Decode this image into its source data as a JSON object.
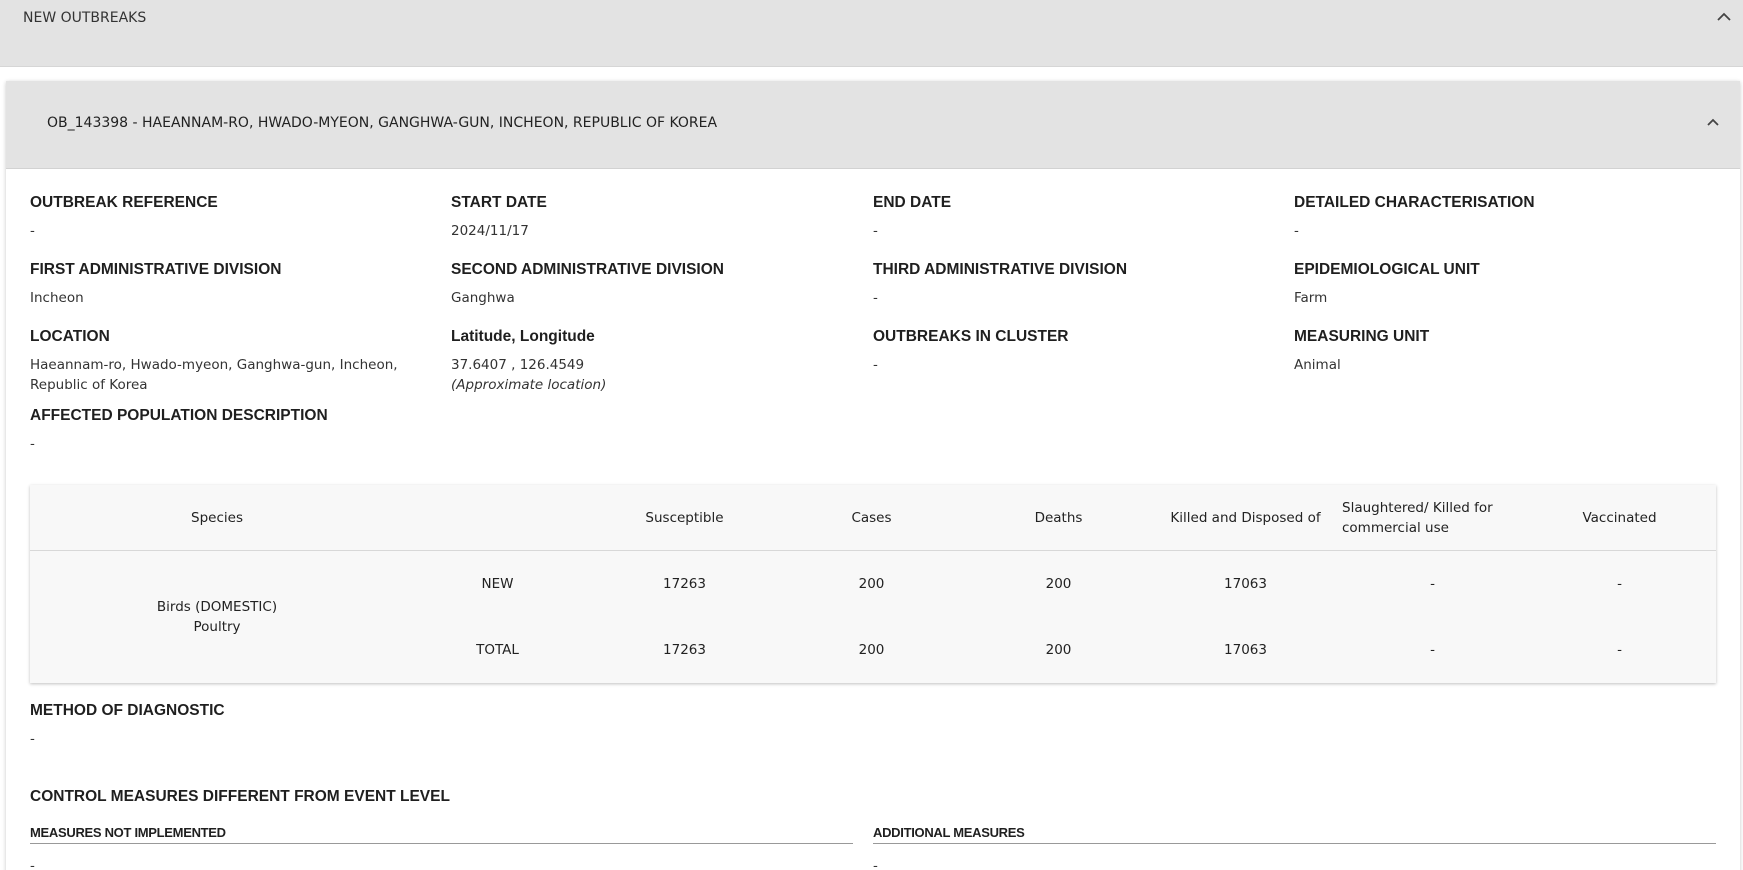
{
  "top_section": {
    "title": "NEW OUTBREAKS",
    "toggle_icon": "chevron-up-icon"
  },
  "outbreak": {
    "title": "OB_143398 - HAEANNAM-RO, HWADO-MYEON, GANGHWA-GUN, INCHEON, REPUBLIC OF KOREA",
    "toggle_icon": "chevron-up-icon"
  },
  "fields": {
    "outbreak_reference": {
      "label": "OUTBREAK REFERENCE",
      "value": "-"
    },
    "start_date": {
      "label": "START DATE",
      "value": "2024/11/17"
    },
    "end_date": {
      "label": "END DATE",
      "value": "-"
    },
    "detailed_characterisation": {
      "label": "DETAILED CHARACTERISATION",
      "value": "-"
    },
    "first_admin_division": {
      "label": "FIRST ADMINISTRATIVE DIVISION",
      "value": "Incheon"
    },
    "second_admin_division": {
      "label": "SECOND ADMINISTRATIVE DIVISION",
      "value": "Ganghwa"
    },
    "third_admin_division": {
      "label": "THIRD ADMINISTRATIVE DIVISION",
      "value": "-"
    },
    "epidemiological_unit": {
      "label": "EPIDEMIOLOGICAL UNIT",
      "value": "Farm"
    },
    "location": {
      "label": "LOCATION",
      "value": "Haeannam-ro, Hwado-myeon, Ganghwa-gun, Incheon, Republic of Korea"
    },
    "lat_long": {
      "label": "Latitude, Longitude",
      "value": "37.6407 , 126.4549",
      "note": "(Approximate location)"
    },
    "outbreaks_in_cluster": {
      "label": "OUTBREAKS IN CLUSTER",
      "value": "-"
    },
    "measuring_unit": {
      "label": "MEASURING UNIT",
      "value": "Animal"
    },
    "affected_population": {
      "label": "AFFECTED POPULATION DESCRIPTION",
      "value": "-"
    }
  },
  "population_table": {
    "headers": {
      "species": "Species",
      "susceptible": "Susceptible",
      "cases": "Cases",
      "deaths": "Deaths",
      "killed_disposed": "Killed and Disposed of",
      "slaughtered": "Slaughtered/ Killed for commercial use",
      "vaccinated": "Vaccinated"
    },
    "species_line1": "Birds (DOMESTIC)",
    "species_line2": "Poultry",
    "rows": [
      {
        "type": "NEW",
        "susceptible": "17263",
        "cases": "200",
        "deaths": "200",
        "killed_disposed": "17063",
        "slaughtered": "-",
        "vaccinated": "-"
      },
      {
        "type": "TOTAL",
        "susceptible": "17263",
        "cases": "200",
        "deaths": "200",
        "killed_disposed": "17063",
        "slaughtered": "-",
        "vaccinated": "-"
      }
    ]
  },
  "method_of_diagnostic": {
    "label": "METHOD OF DIAGNOSTIC",
    "value": "-"
  },
  "control_measures": {
    "title": "CONTROL MEASURES DIFFERENT FROM EVENT LEVEL",
    "not_implemented": {
      "label": "MEASURES NOT IMPLEMENTED",
      "value": "-"
    },
    "additional": {
      "label": "ADDITIONAL MEASURES",
      "value": "-"
    }
  }
}
